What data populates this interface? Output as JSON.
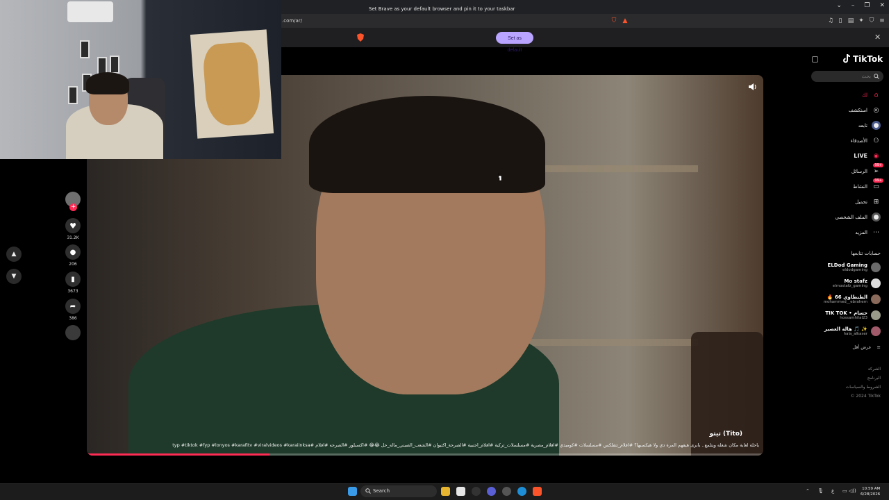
{
  "browser": {
    "url": ".com/ar/",
    "banner_text": "Set Brave as your default browser and pin it to your taskbar",
    "banner_button": "Set as default",
    "close_glyph": "✕",
    "window_controls": [
      "⌄",
      "–",
      "❐",
      "✕"
    ]
  },
  "tiktok": {
    "logo": "TikTok",
    "search_placeholder": "بحث",
    "nav": [
      {
        "label": "لك",
        "icon": "home-icon",
        "active": true
      },
      {
        "label": "استكشف",
        "icon": "compass-icon"
      },
      {
        "label": "LIVE",
        "icon": "live-icon"
      },
      {
        "label": "الأصدقاء",
        "icon": "friends-icon"
      },
      {
        "label": "الرسائل",
        "icon": "messages-icon",
        "badge": "99+"
      },
      {
        "label": "النشاط",
        "icon": "activity-icon",
        "badge": "99+"
      },
      {
        "label": "تحميل",
        "icon": "upload-icon"
      },
      {
        "label": "الملف الشخصي",
        "icon": "profile-icon"
      },
      {
        "label": "المزيد",
        "icon": "more-icon"
      }
    ],
    "following_header": "حسابات تتابعها",
    "accounts": [
      {
        "name": "ELDod Gaming",
        "handle": "eldodgaming"
      },
      {
        "name": "Mo stafz",
        "handle": "elmostafz_gaming"
      },
      {
        "name": "🔥 الطنطاوي 66",
        "handle": "mohammed__ebrahem"
      },
      {
        "name": "TIK TOK • حسام",
        "handle": "hossamhilal23"
      },
      {
        "name": "هالة العصير 🎵 ✨",
        "handle": "hala_alkaser"
      }
    ],
    "see_less": "عرض أقل",
    "footer": [
      "الشركة",
      "البرنامج",
      "الشروط والسياسات",
      "© 2024 TikTok"
    ],
    "video": {
      "title": "تيتو (Tito)",
      "caption": "ياحلة لغاية مكان شغله ويتلمع.. يابرى هيفهم المرة دي ولا هيكسبها؟ #افلام_تتفلكس #مسلسلات #كوميدي #افلام_مصرية #مسلسلات_تركية #افلام_اجنبية #الصرحة_اكتيوان #الشعب_الصيني_ماله_حل 😂😂 #اكسبلور #الصرحه #اقلام #typ #tiktok #fyp #lonyos #karafitv #viralvideos #karaiinksa",
      "progress": 0.27,
      "likes": "31.2K",
      "comments": "206",
      "saves": "3673",
      "shares": "386"
    }
  },
  "taskbar": {
    "search": "Search",
    "time": "10:59 AM",
    "date": "6/28/2026",
    "lang": "ع"
  },
  "colors": {
    "brand": "#fe2c55",
    "banner_button": "#b9a4ff",
    "background": "#000000"
  }
}
